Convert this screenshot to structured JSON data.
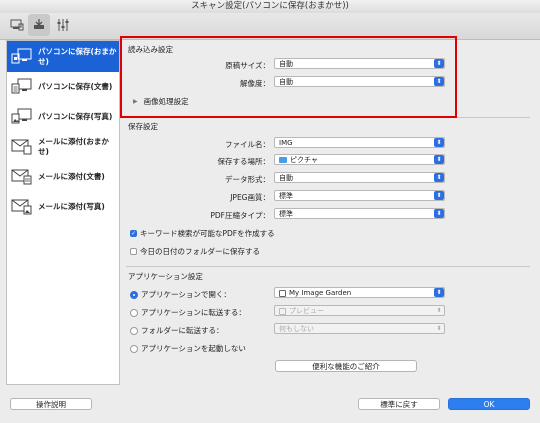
{
  "window": {
    "title": "スキャン設定(パソコンに保存(おまかせ))"
  },
  "toolbar": {
    "tabs": [
      "scan-from-computer-icon",
      "scan-from-operation-panel-icon",
      "general-settings-icon"
    ]
  },
  "sidebar": {
    "items": [
      {
        "label": "パソコンに保存(おまかせ)",
        "icon": "save-auto-icon",
        "selected": true
      },
      {
        "label": "パソコンに保存(文書)",
        "icon": "save-document-icon",
        "selected": false
      },
      {
        "label": "パソコンに保存(写真)",
        "icon": "save-photo-icon",
        "selected": false
      },
      {
        "label": "メールに添付(おまかせ)",
        "icon": "mail-auto-icon",
        "selected": false
      },
      {
        "label": "メールに添付(文書)",
        "icon": "mail-document-icon",
        "selected": false
      },
      {
        "label": "メールに添付(写真)",
        "icon": "mail-photo-icon",
        "selected": false
      }
    ]
  },
  "scan_options": {
    "title": "読み込み設定",
    "paper_size_label": "原稿サイズ：",
    "paper_size_value": "自動",
    "resolution_label": "解像度：",
    "resolution_value": "自動",
    "image_processing_label": "画像処理設定"
  },
  "save_settings": {
    "title": "保存設定",
    "file_name_label": "ファイル名：",
    "file_name_value": "IMG",
    "save_in_label": "保存する場所：",
    "save_in_value": "ピクチャ",
    "data_format_label": "データ形式：",
    "data_format_value": "自動",
    "jpeg_quality_label": "JPEG画質：",
    "jpeg_quality_value": "標準",
    "pdf_compression_label": "PDF圧縮タイプ：",
    "pdf_compression_value": "標準",
    "keyword_pdf_label": "キーワード検索が可能なPDFを作成する",
    "date_folder_label": "今日の日付のフォルダーに保存する"
  },
  "app_settings": {
    "title": "アプリケーション設定",
    "open_with_label": "アプリケーションで開く：",
    "open_with_value": "My Image Garden",
    "send_to_app_label": "アプリケーションに転送する：",
    "send_to_app_value": "プレビュー",
    "send_to_folder_label": "フォルダーに転送する：",
    "send_to_folder_value": "何もしない",
    "do_not_start_label": "アプリケーションを起動しない",
    "more_functions_label": "便利な機能のご紹介"
  },
  "footer": {
    "instructions_label": "操作説明",
    "defaults_label": "標準に戻す",
    "ok_label": "OK"
  },
  "colors": {
    "accent": "#2d6fe0",
    "selection": "#1a62d6",
    "highlight": "#e00000"
  }
}
